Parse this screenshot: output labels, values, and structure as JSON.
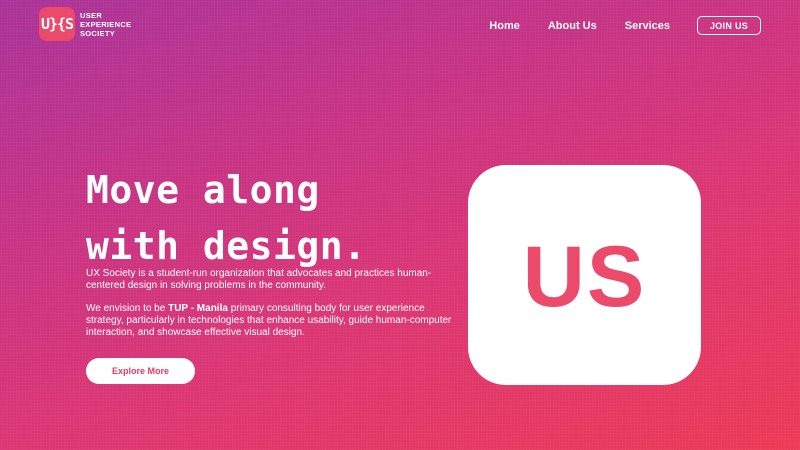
{
  "brand": {
    "mark": "U}{S",
    "name_lines": [
      "USER",
      "EXPERIENCE",
      "SOCIETY"
    ]
  },
  "nav": {
    "links": [
      "Home",
      "About Us",
      "Services"
    ],
    "join_label": "JOIN US"
  },
  "hero": {
    "headline_lines": [
      "Move along",
      "with design."
    ],
    "intro": "UX Society is a student-run organization that advocates and practices human-centered design in solving problems in the community.",
    "vision_prefix": "We envision to be ",
    "vision_bold": "TUP - Manila",
    "vision_suffix": " primary consulting body for user experience strategy, particularly in technologies that enhance usability, guide human-computer interaction, and showcase effective visual design.",
    "cta_label": "Explore More",
    "card_text": "US"
  },
  "colors": {
    "gradient_top": "#a93399",
    "gradient_bottom": "#ec3a56",
    "accent": "#ec4a6a",
    "text": "#ffffff"
  }
}
